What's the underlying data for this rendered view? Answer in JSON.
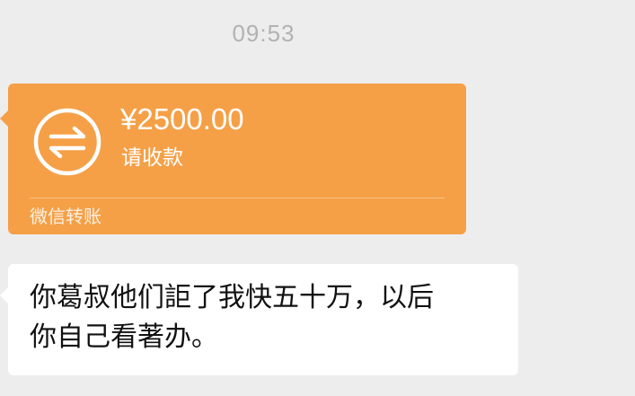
{
  "chat": {
    "timestamp": "09:53",
    "transfer": {
      "amount": "¥2500.00",
      "status": "请收款",
      "footer": "微信转账",
      "icon": "transfer-arrows-icon",
      "color": "#f5a047"
    },
    "message": {
      "text": "你葛叔他们詎了我快五十万，以后\n你自己看著办。"
    }
  }
}
